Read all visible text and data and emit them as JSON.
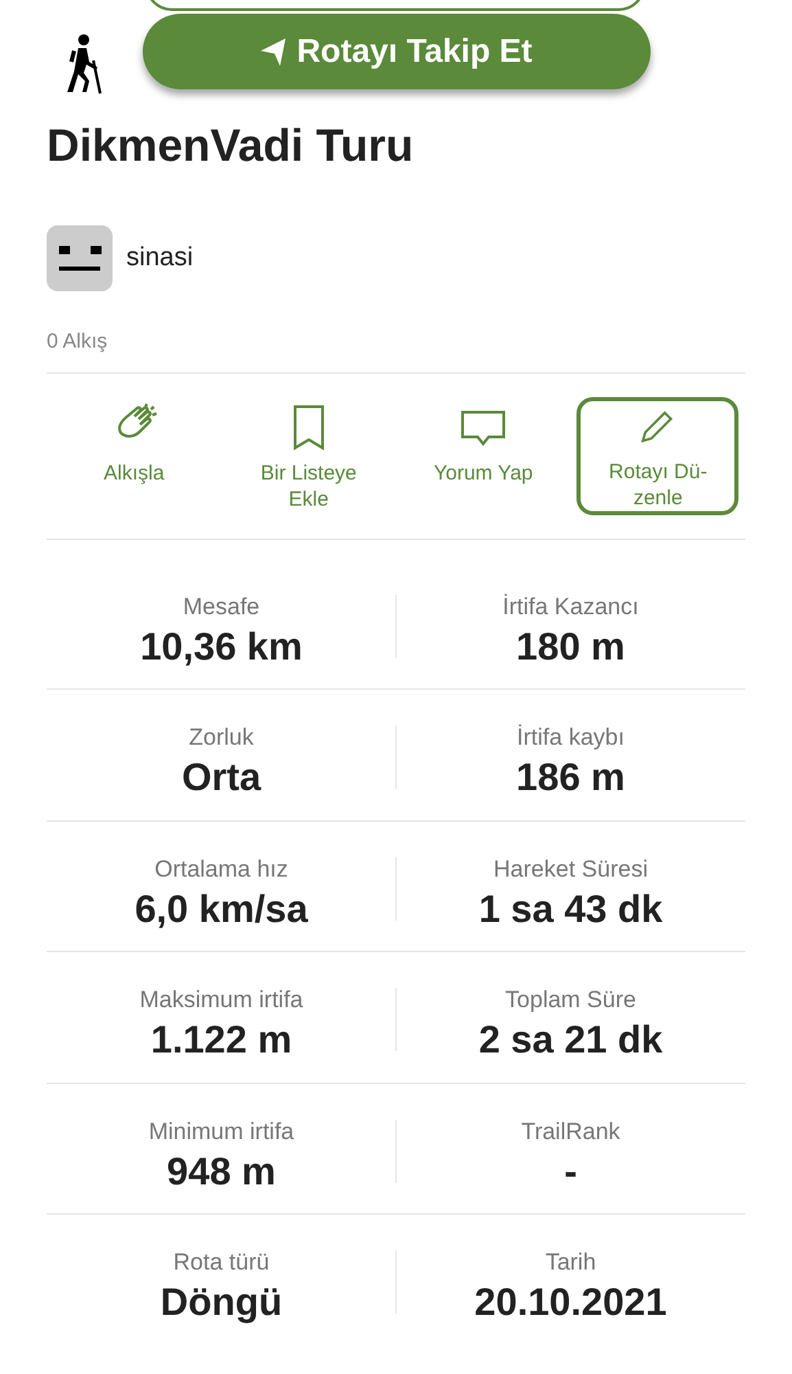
{
  "follow_button": {
    "label": "Rotayı Takip Et"
  },
  "title": "DikmenVadi Turu",
  "author": {
    "name": "sinasi"
  },
  "claps": "0 Alkış",
  "actions": [
    {
      "kind": "clap",
      "label": "Alkışla",
      "outlined": false
    },
    {
      "kind": "bookmark",
      "label": "Bir Listeye Ekle",
      "outlined": false
    },
    {
      "kind": "comment",
      "label": "Yorum Yap",
      "outlined": false
    },
    {
      "kind": "edit",
      "label": "Rotayı Dü-zenle",
      "outlined": true
    }
  ],
  "stats": [
    {
      "label": "Mesafe",
      "value": "10,36 km"
    },
    {
      "label": "İrtifa Kazancı",
      "value": "180 m"
    },
    {
      "label": "Zorluk",
      "value": "Orta"
    },
    {
      "label": "İrtifa kaybı",
      "value": "186 m"
    },
    {
      "label": "Ortalama hız",
      "value": "6,0 km/sa"
    },
    {
      "label": "Hareket Süresi",
      "value": "1 sa 43 dk"
    },
    {
      "label": "Maksimum irtifa",
      "value": "1.122 m"
    },
    {
      "label": "Toplam Süre",
      "value": "2 sa 21 dk"
    },
    {
      "label": "Minimum irtifa",
      "value": "948 m"
    },
    {
      "label": "TrailRank",
      "value": "-"
    },
    {
      "label": "Rota türü",
      "value": "Döngü"
    },
    {
      "label": "Tarih",
      "value": "20.10.2021"
    }
  ]
}
